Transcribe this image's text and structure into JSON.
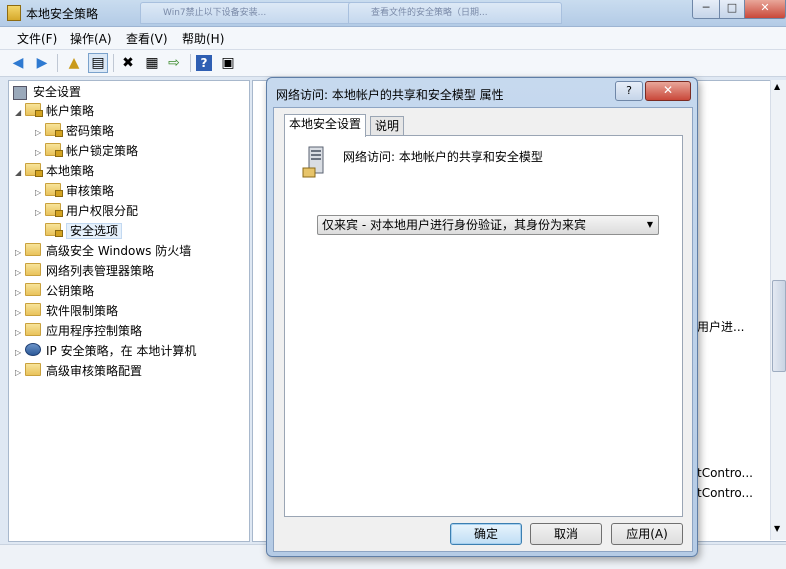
{
  "window": {
    "title": "本地安全策略",
    "ghost_tabs": [
      "Win7禁止以下设备安装...",
      "查看文件的安全策略（日期..."
    ],
    "min": "─",
    "max": "□",
    "close": "✕"
  },
  "menu": [
    "文件(F)",
    "操作(A)",
    "查看(V)",
    "帮助(H)"
  ],
  "tree": {
    "root": "安全设置",
    "items": [
      {
        "label": "帐户策略",
        "level": 1,
        "expanded": true
      },
      {
        "label": "密码策略",
        "level": 2
      },
      {
        "label": "帐户锁定策略",
        "level": 2
      },
      {
        "label": "本地策略",
        "level": 1,
        "expanded": true
      },
      {
        "label": "审核策略",
        "level": 2
      },
      {
        "label": "用户权限分配",
        "level": 2
      },
      {
        "label": "安全选项",
        "level": 2,
        "selected": true
      },
      {
        "label": "高级安全 Windows 防火墙",
        "level": 1
      },
      {
        "label": "网络列表管理器策略",
        "level": 1
      },
      {
        "label": "公钥策略",
        "level": 1
      },
      {
        "label": "软件限制策略",
        "level": 1
      },
      {
        "label": "应用程序控制策略",
        "level": 1
      },
      {
        "label": "IP 安全策略，在 本地计算机",
        "level": 1
      },
      {
        "label": "高级审核策略配置",
        "level": 1
      }
    ]
  },
  "right_list": {
    "visible_fragments": [
      "用户进...",
      "tContro...",
      "tContro..."
    ]
  },
  "dialog": {
    "title": "网络访问: 本地帐户的共享和安全模型 属性",
    "help": "?",
    "close": "✕",
    "tabs": [
      "本地安全设置",
      "说明"
    ],
    "policy_name": "网络访问: 本地帐户的共享和安全模型",
    "selected_value": "仅来宾 - 对本地用户进行身份验证，其身份为来宾",
    "buttons": {
      "ok": "确定",
      "cancel": "取消",
      "apply": "应用(A)"
    }
  }
}
